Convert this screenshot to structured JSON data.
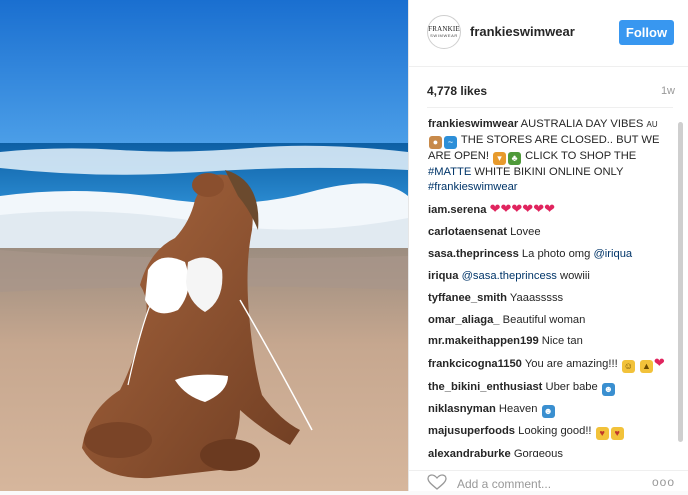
{
  "post": {
    "avatar_line1": "FRANKIE",
    "avatar_line2": "SWIMWEAR",
    "username": "frankieswimwear",
    "follow_label": "Follow",
    "likes": "4,778 likes",
    "age": "1w"
  },
  "caption": {
    "user": "frankieswimwear",
    "text_1": "AUSTRALIA DAY VIBES",
    "flag_text": "AU",
    "text_2": "THE STORES ARE CLOSED.. BUT WE ARE OPEN!",
    "text_3": "CLICK TO SHOP THE",
    "hashtag_1": "#MATTE",
    "text_4": "WHITE BIKINI ONLINE ONLY",
    "hashtag_2": "#frankieswimwear"
  },
  "comments": [
    {
      "user": "iam.serena",
      "text": ""
    },
    {
      "user": "carlotaensenat",
      "text": "Lovee"
    },
    {
      "user": "sasa.theprincess",
      "text": "La photo omg",
      "mention": "@iriqua"
    },
    {
      "user": "iriqua",
      "mention": "@sasa.theprincess",
      "text": "wowiii"
    },
    {
      "user": "tyffanee_smith",
      "text": "Yaaasssss"
    },
    {
      "user": "omar_aliaga_",
      "text": "Beautiful woman"
    },
    {
      "user": "mr.makeithappen199",
      "text": "Nice tan"
    },
    {
      "user": "frankcicogna1150",
      "text": "You are amazing!!!"
    },
    {
      "user": "the_bikini_enthusiast",
      "text": "Uber babe"
    },
    {
      "user": "niklasnyman",
      "text": "Heaven"
    },
    {
      "user": "majusuperfoods",
      "text": "Looking good!!"
    },
    {
      "user": "alexandraburke",
      "text": "Gorgeous"
    }
  ],
  "footer": {
    "placeholder": "Add a comment...",
    "more": "ooo"
  },
  "icons": {
    "heart": "heart-icon",
    "heart_outline": "heart-outline-icon",
    "more": "more-options-icon"
  },
  "colors": {
    "accent": "#3897f0",
    "link": "#003569",
    "heart": "#e0245e"
  }
}
